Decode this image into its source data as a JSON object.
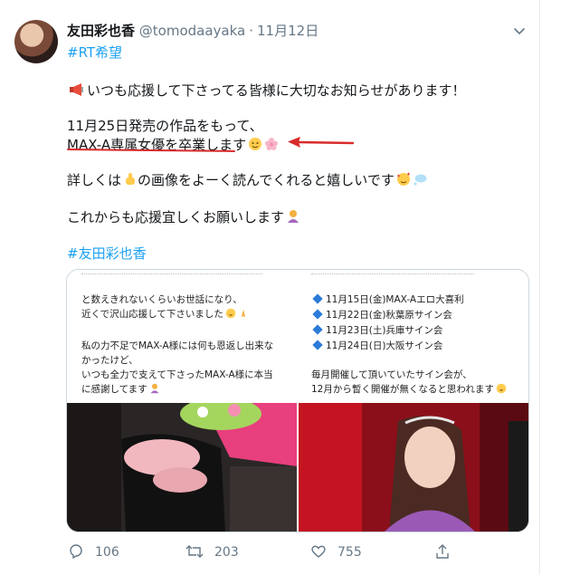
{
  "tweet": {
    "display_name": "友田彩也香",
    "handle": "@tomodaayaka",
    "separator": "·",
    "date": "11月12日",
    "hashtag_top": "#RT希望",
    "lines": [
      "いつも応援して下さってる皆様に大切なお知らせがあります！",
      "11月25日発売の作品をもって、",
      "MAX-A専属女優を卒業します",
      "詳しくは",
      "の画像をよーく読んでくれると嬉しいです",
      "これからも応援宜しくお願いします"
    ],
    "hashtag_bottom": "#友田彩也香"
  },
  "images": {
    "left_text": [
      "と数えきれないくらいお世話になり、",
      "近くで沢山応援して下さいました",
      "私の力不足でMAX-A様には何も恩返し出来な",
      "かったけど、",
      "いつも全力で支えて下さったMAX-A様に本当",
      "に感謝してます"
    ],
    "right_events": [
      "11月15日(金)MAX-Aエロ大喜利",
      "11月22日(金)秋葉原サイン会",
      "11月23日(土)兵庫サイン会",
      "11月24日(日)大阪サイン会"
    ],
    "right_text": [
      "毎月開催して頂いていたサイン会が、",
      "12月から暫く開催が無くなると思われます"
    ]
  },
  "actions": {
    "replies": "106",
    "retweets": "203",
    "likes": "755"
  },
  "colors": {
    "link": "#1da1f2",
    "annotation_red": "#d92b2b",
    "muted": "#657786"
  }
}
